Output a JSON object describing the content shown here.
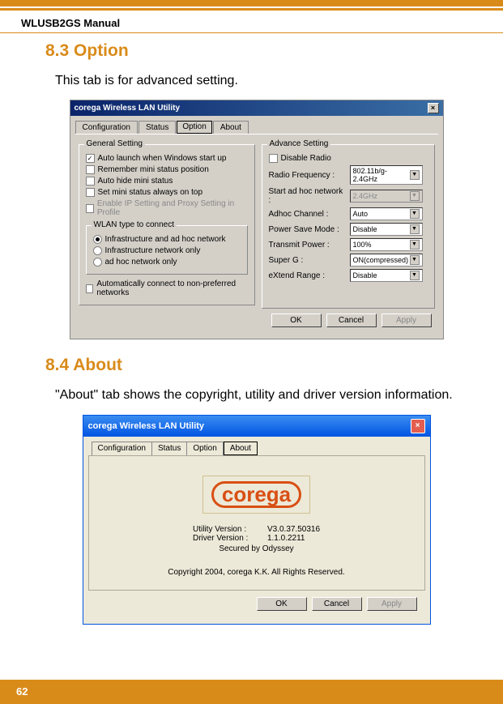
{
  "page": {
    "manual_title": "WLUSB2GS Manual",
    "number": "62"
  },
  "section1": {
    "heading": "8.3 Option",
    "text": "This tab is for advanced setting."
  },
  "section2": {
    "heading": "8.4 About",
    "text": "\"About\" tab shows the copyright, utility and driver version information."
  },
  "dlg1": {
    "title": "corega Wireless LAN Utility",
    "tabs": [
      "Configuration",
      "Status",
      "Option",
      "About"
    ],
    "general": {
      "title": "General Setting",
      "items": [
        {
          "label": "Auto launch when Windows start up",
          "checked": true
        },
        {
          "label": "Remember mini status position",
          "checked": false
        },
        {
          "label": "Auto hide mini status",
          "checked": false
        },
        {
          "label": "Set mini status always on top",
          "checked": false
        },
        {
          "label": "Enable IP Setting and Proxy Setting in Profile",
          "checked": false,
          "disabled": true
        }
      ]
    },
    "wlan_type": {
      "title": "WLAN type to connect",
      "items": [
        {
          "label": "Infrastructure and ad hoc network",
          "checked": true
        },
        {
          "label": "Infrastructure network only",
          "checked": false
        },
        {
          "label": "ad hoc network only",
          "checked": false
        }
      ],
      "auto_connect": {
        "label": "Automatically connect to non-preferred networks",
        "checked": false
      }
    },
    "advance": {
      "title": "Advance Setting",
      "disable_radio": {
        "label": "Disable Radio",
        "checked": false
      },
      "rows": [
        {
          "label": "Radio Frequency :",
          "value": "802.11b/g-2.4GHz"
        },
        {
          "label": "Start ad hoc network :",
          "value": "2.4GHz",
          "disabled": true
        },
        {
          "label": "Adhoc Channel :",
          "value": "Auto"
        },
        {
          "label": "Power Save Mode :",
          "value": "Disable"
        },
        {
          "label": "Transmit Power :",
          "value": "100%"
        },
        {
          "label": "Super G :",
          "value": "ON(compressed)"
        },
        {
          "label": "eXtend Range :",
          "value": "Disable"
        }
      ]
    },
    "buttons": {
      "ok": "OK",
      "cancel": "Cancel",
      "apply": "Apply"
    }
  },
  "dlg2": {
    "title": "corega Wireless LAN Utility",
    "tabs": [
      "Configuration",
      "Status",
      "Option",
      "About"
    ],
    "logo": "corega",
    "utility_label": "Utility Version :",
    "utility_value": "V3.0.37.50316",
    "driver_label": "Driver Version :",
    "driver_value": "1.1.0.2211",
    "secured": "Secured by Odyssey",
    "copyright": "Copyright 2004, corega K.K. All Rights Reserved.",
    "buttons": {
      "ok": "OK",
      "cancel": "Cancel",
      "apply": "Apply"
    }
  }
}
